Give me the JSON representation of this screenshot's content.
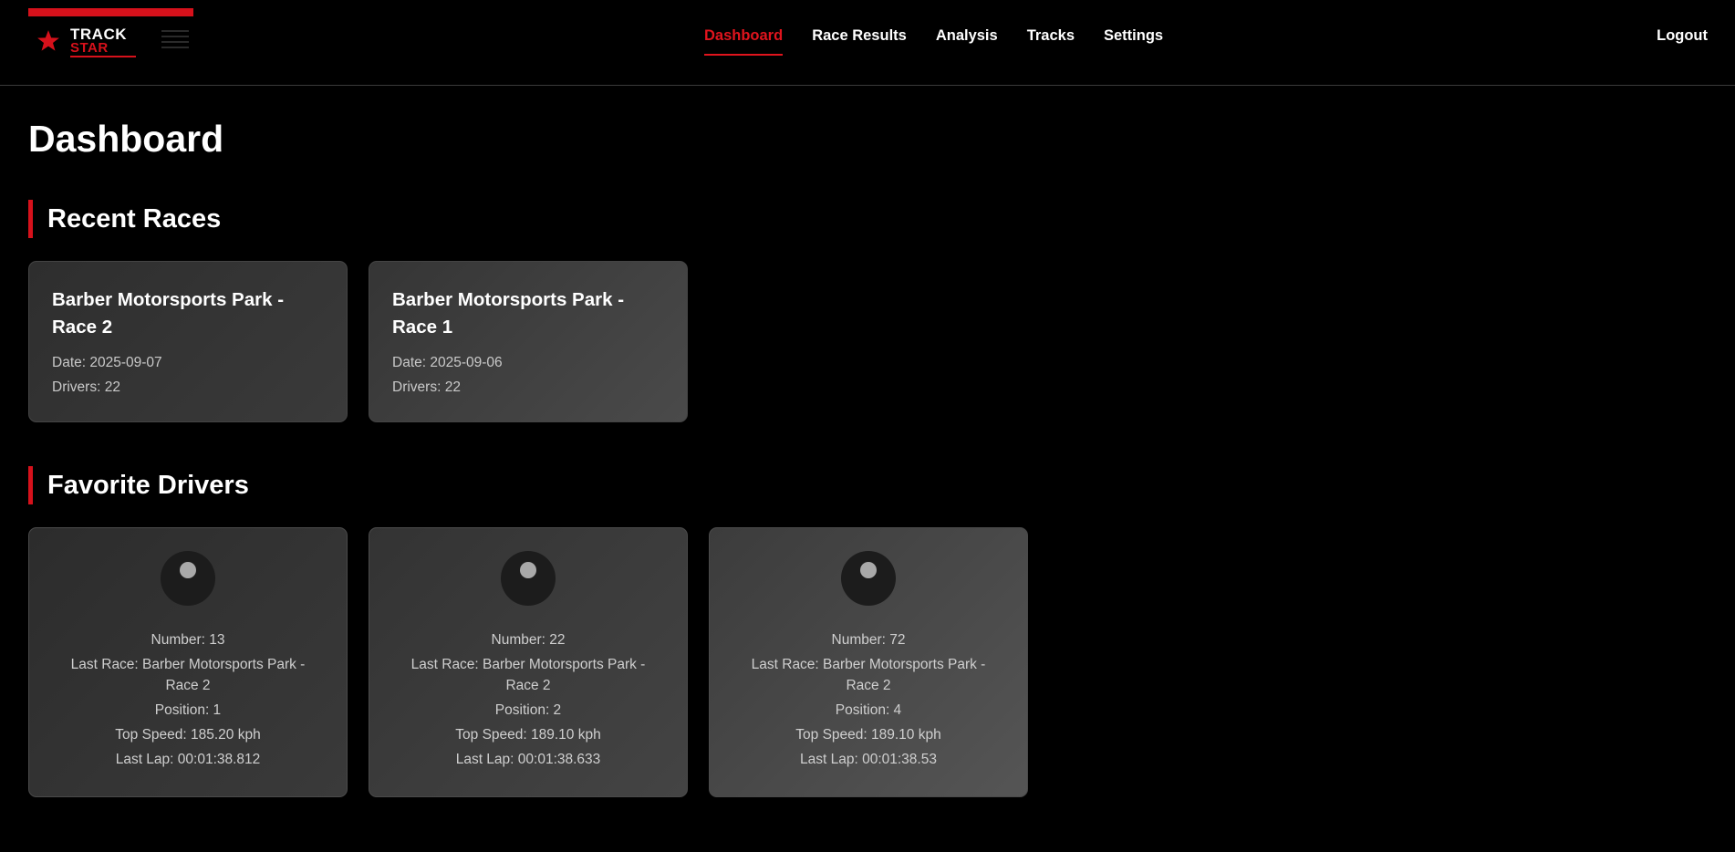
{
  "brand": {
    "line1": "TRACK",
    "line2": "STAR",
    "accent_color": "#d6111b"
  },
  "nav": {
    "items": [
      {
        "label": "Dashboard",
        "active": true
      },
      {
        "label": "Race Results",
        "active": false
      },
      {
        "label": "Analysis",
        "active": false
      },
      {
        "label": "Tracks",
        "active": false
      },
      {
        "label": "Settings",
        "active": false
      }
    ],
    "logout_label": "Logout"
  },
  "page": {
    "title": "Dashboard"
  },
  "recent_races": {
    "heading": "Recent Races",
    "races": [
      {
        "title": "Barber Motorsports Park - Race 2",
        "date": "Date: 2025-09-07",
        "drivers": "Drivers: 22"
      },
      {
        "title": "Barber Motorsports Park - Race 1",
        "date": "Date: 2025-09-06",
        "drivers": "Drivers: 22"
      }
    ]
  },
  "favorite_drivers": {
    "heading": "Favorite Drivers",
    "drivers": [
      {
        "number": "Number: 13",
        "last_race": "Last Race: Barber Motorsports Park - Race 2",
        "position": "Position: 1",
        "top_speed": "Top Speed: 185.20 kph",
        "last_lap": "Last Lap: 00:01:38.812",
        "avatar_icon": "driver-avatar-icon"
      },
      {
        "number": "Number: 22",
        "last_race": "Last Race: Barber Motorsports Park - Race 2",
        "position": "Position: 2",
        "top_speed": "Top Speed: 189.10 kph",
        "last_lap": "Last Lap: 00:01:38.633",
        "avatar_icon": "driver-avatar-icon"
      },
      {
        "number": "Number: 72",
        "last_race": "Last Race: Barber Motorsports Park - Race 2",
        "position": "Position: 4",
        "top_speed": "Top Speed: 189.10 kph",
        "last_lap": "Last Lap: 00:01:38.53",
        "avatar_icon": "driver-avatar-icon"
      }
    ]
  },
  "colors": {
    "background": "#000000",
    "accent": "#e0141d",
    "card_text": "#cfcfcf"
  }
}
